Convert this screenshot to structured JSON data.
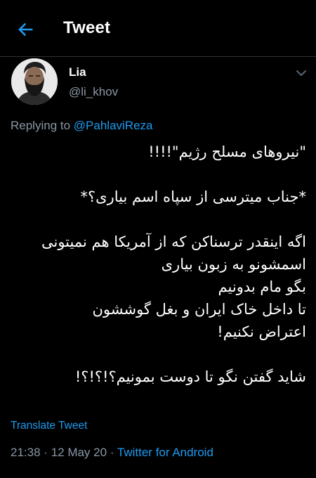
{
  "header": {
    "title": "Tweet",
    "back_icon": "arrow-left-icon",
    "accent_color": "#1d9bf0"
  },
  "tweet": {
    "author": {
      "name": "Lia",
      "handle": "@li_khov",
      "avatar_icon": "user-avatar-photo"
    },
    "menu_icon": "chevron-down-icon",
    "reply_prefix": "Replying to",
    "reply_to": "@PahlaviReza",
    "lines": [
      "\"نیروهای مسلح رژیم\"!!!!",
      "",
      "*جناب میترسی از سپاه اسم بیاری؟*",
      "",
      "اگه اینقدر ترسناکن که از آمریکا هم نمیتونی",
      "اسمشونو به زبون بیاری",
      "بگو مام بدونیم",
      "تا داخل خاک ایران و بغل گوششون",
      "اعتراض نکنیم!",
      "",
      "شاید گفتن نگو تا دوست بمونیم؟!؟!؟!"
    ],
    "translate_label": "Translate Tweet",
    "time": "21:38",
    "date": "12 May 20",
    "separator": "·",
    "client": "Twitter for Android"
  }
}
